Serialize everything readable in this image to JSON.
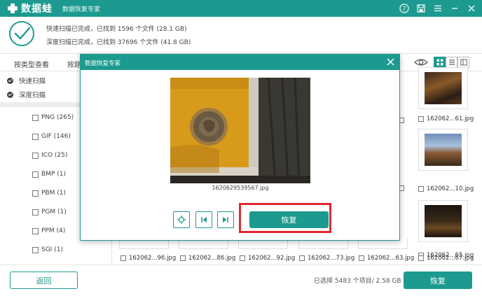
{
  "app": {
    "logo_text": "数据蛙",
    "subtitle": "数据恢复专家"
  },
  "status": {
    "quick_scan": "快速扫描已完成，已找到 1596 个文件 (28.1 GB)",
    "deep_scan": "深度扫描已完成，已找到 37696 个文件 (41.8 GB)"
  },
  "tabs": {
    "by_type": "按类型查看",
    "by_path": "按路"
  },
  "sidebar": {
    "quick_scan": "快速扫描",
    "deep_scan": "深度扫描",
    "file_types": [
      {
        "label": "PNG (265)"
      },
      {
        "label": "GIF (146)"
      },
      {
        "label": "ICO (25)"
      },
      {
        "label": "BMP (1)"
      },
      {
        "label": "PBM (1)"
      },
      {
        "label": "PGM (1)"
      },
      {
        "label": "PPM (4)"
      },
      {
        "label": "SGI (1)"
      }
    ]
  },
  "grid": {
    "right_column_labels": [
      "162062...61.jpg",
      "162062...10.jpg",
      "162062...65.jpg"
    ],
    "bottom_row_labels": [
      "162062...96.jpg",
      "162062...86.jpg",
      "162062...92.jpg",
      "162062...73.jpg",
      "162062...63.jpg",
      "162062...67.jpg"
    ]
  },
  "modal": {
    "title": "数据恢复专家",
    "filename": "1620629539567.jpg",
    "recover_label": "恢复"
  },
  "bottom": {
    "back_label": "返回",
    "selection_info": "已选择 5483 个项目/ 2.58 GB",
    "recover_label": "恢复"
  },
  "colors": {
    "accent": "#1c9a8f",
    "highlight": "#e0282e"
  }
}
